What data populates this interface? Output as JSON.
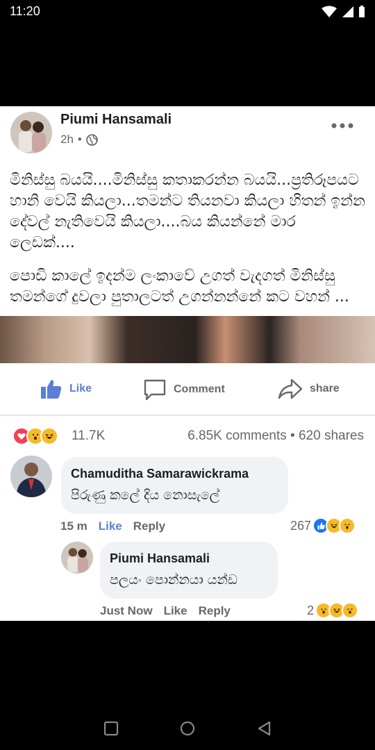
{
  "status_bar": {
    "time": "11:20"
  },
  "post": {
    "author": "Piumi Hansamali",
    "time": "2h",
    "separator": "•",
    "paragraph1": "මිනිස්සු බයයි....මිනිස්සු කතාකරන්න බයයි...ප්‍රතිරූපයට හානි වෙයි කියලා...තමන්ට තියනවා කියලා හිතන් ඉන්න දේවල් නැතිවෙයි කියලා....බය කියන්නේ මාර ලෙඩක්....",
    "paragraph2": "පොඩි කාලේ ඉදන්ම ලංකාවේ උගත් වැදගත් මිනිස්සු තමන්ගේ දුවලා පුතාලටත් උගන්නන්නේ කට වහන් ..."
  },
  "actions": {
    "like": "Like",
    "comment": "Comment",
    "share": "share"
  },
  "stats": {
    "reaction_count": "11.7K",
    "comments_shares": "6.85K comments • 620 shares"
  },
  "comment1": {
    "author": "Chamuditha Samarawickrama",
    "text": "පිරුණු කලේ දිය නොසැලේ",
    "time": "15 m",
    "like": "Like",
    "reply": "Reply",
    "reaction_count": "267"
  },
  "reply1": {
    "author": "Piumi Hansamali",
    "text": "පලයං පොන්නයා යන්ඩ",
    "time": "Just Now",
    "like": "Like",
    "reply": "Reply",
    "reaction_count": "2"
  },
  "colors": {
    "like_blue": "#5b7fd6",
    "love_red": "#f33e58",
    "haha_yellow": "#f7b928"
  }
}
